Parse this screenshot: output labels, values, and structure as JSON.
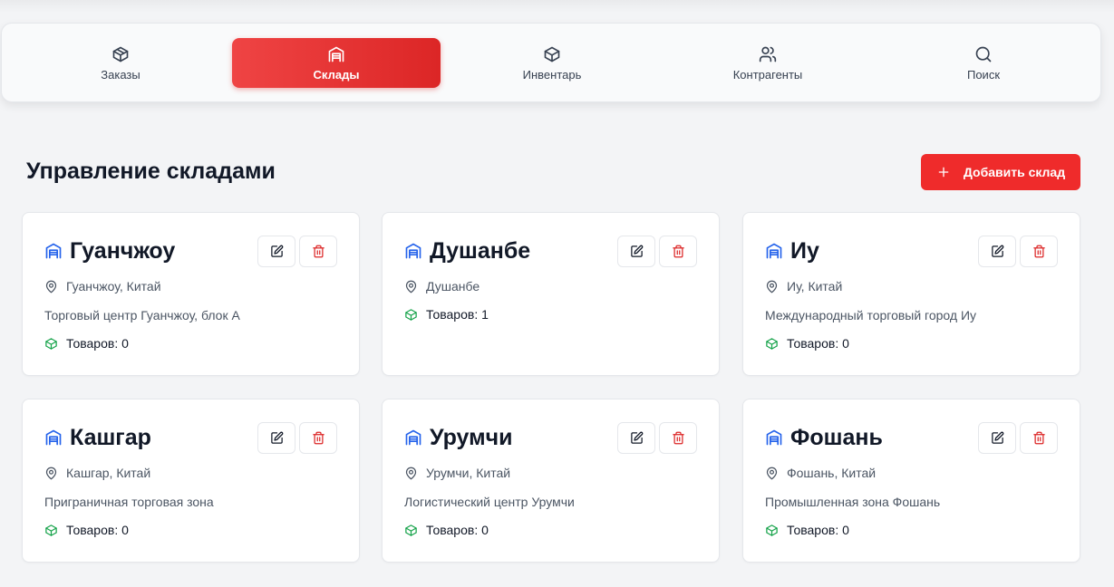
{
  "nav": {
    "items": [
      {
        "label": "Заказы",
        "icon": "package-icon",
        "active": false
      },
      {
        "label": "Склады",
        "icon": "warehouse-icon",
        "active": true
      },
      {
        "label": "Инвентарь",
        "icon": "box-icon",
        "active": false
      },
      {
        "label": "Контрагенты",
        "icon": "users-icon",
        "active": false
      },
      {
        "label": "Поиск",
        "icon": "search-icon",
        "active": false
      }
    ]
  },
  "page": {
    "title": "Управление складами",
    "add_button": "Добавить склад"
  },
  "colors": {
    "accent": "#ef2b2b",
    "warehouse_icon": "#2563eb",
    "count_icon": "#16a34a",
    "delete_icon": "#dc2626"
  },
  "warehouses": [
    {
      "name": "Гуанчжоу",
      "location": "Гуанчжоу, Китай",
      "description": "Торговый центр Гуанчжоу, блок А",
      "count": "Товаров: 0"
    },
    {
      "name": "Душанбе",
      "location": "Душанбе",
      "description": "",
      "count": "Товаров: 1"
    },
    {
      "name": "Иу",
      "location": "Иу, Китай",
      "description": "Международный торговый город Иу",
      "count": "Товаров: 0"
    },
    {
      "name": "Кашгар",
      "location": "Кашгар, Китай",
      "description": "Приграничная торговая зона",
      "count": "Товаров: 0"
    },
    {
      "name": "Урумчи",
      "location": "Урумчи, Китай",
      "description": "Логистический центр Урумчи",
      "count": "Товаров: 0"
    },
    {
      "name": "Фошань",
      "location": "Фошань, Китай",
      "description": "Промышленная зона Фошань",
      "count": "Товаров: 0"
    }
  ]
}
